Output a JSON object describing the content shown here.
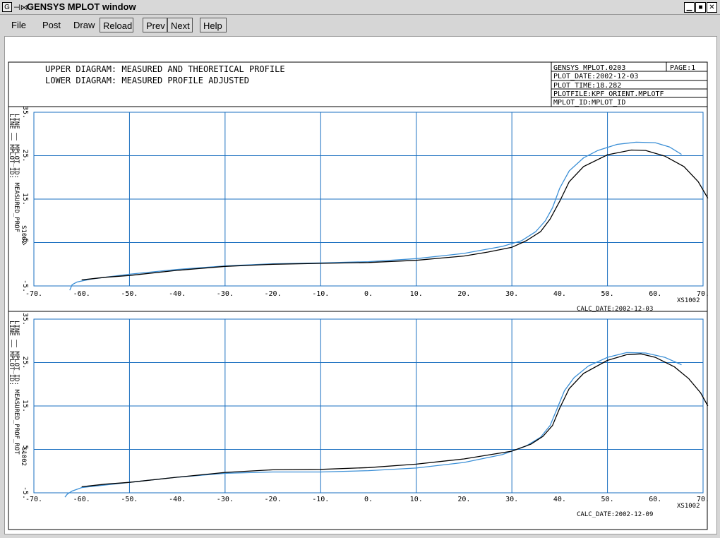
{
  "window": {
    "title": "GENSYS MPLOT window",
    "icon_label": "G"
  },
  "menu": {
    "file": "File",
    "post": "Post",
    "draw": "Draw",
    "reload": "Reload",
    "prev": "Prev",
    "next": "Next",
    "help": "Help"
  },
  "header": {
    "line1": "UPPER DIAGRAM: MEASURED AND THEORETICAL PROFILE",
    "line2": "LOWER DIAGRAM: MEASURED PROFILE ADJUSTED",
    "info": [
      "GENSYS MPLOT.0203",
      "PLOT_DATE:2002-12-03",
      "PLOT_TIME:18.282",
      "PLOTFILE:KPF_ORIENT.MPLOTF",
      "MPLOT_ID:MPLOT_ID"
    ],
    "page": "PAGE:1"
  },
  "colors": {
    "measured": "#3b8fd6",
    "theoretical": "#000000",
    "grid": "#1a6fc0"
  },
  "chart_data": [
    {
      "type": "line",
      "xlim": [
        -70,
        70
      ],
      "ylim": [
        -5,
        35
      ],
      "x_ticks": [
        "-70.",
        "-60.",
        "-50.",
        "-40.",
        "-30.",
        "-20.",
        "-10.",
        "0.",
        "10.",
        "20.",
        "30.",
        "40.",
        "50.",
        "60.",
        "70."
      ],
      "y_ticks": [
        "-5.",
        "5.",
        "15.",
        "25.",
        "35."
      ],
      "xlabel": "XS1002",
      "ylabel": "S1002",
      "legend": [
        "LINE —— MPLOT_ID:",
        "LINE —— MPLOT_ID: MEASURED_PROF"
      ],
      "footer": "CALC_DATE:2002-12-03",
      "series": [
        {
          "name": "MEASURED_PROF",
          "color": "#3b8fd6",
          "x": [
            -62.5,
            -62,
            -61,
            -58,
            -50,
            -40,
            -30,
            -20,
            -10,
            0,
            10,
            20,
            28,
            32,
            35,
            37,
            38.5,
            40,
            42,
            45,
            48,
            52,
            56,
            60,
            63,
            65.5
          ],
          "y": [
            -6,
            -4.7,
            -4.1,
            -3.4,
            -2.3,
            -1.2,
            -0.4,
            0.1,
            0.3,
            0.6,
            1.3,
            2.5,
            4.1,
            5.4,
            7.5,
            10,
            13,
            17.5,
            21.5,
            24.5,
            26.2,
            27.6,
            28.1,
            28,
            27,
            25.3
          ]
        },
        {
          "name": "MPLOT_ID",
          "color": "#000000",
          "x": [
            -60,
            -55,
            -50,
            -40,
            -30,
            -20,
            -10,
            0,
            10,
            20,
            25,
            30,
            33,
            36,
            38,
            40,
            42,
            45,
            50,
            55,
            58,
            62,
            66,
            69,
            71
          ],
          "y": [
            -3.6,
            -3,
            -2.6,
            -1.4,
            -0.5,
            0,
            0.2,
            0.4,
            0.9,
            1.9,
            2.8,
            3.9,
            5.4,
            7.5,
            10.4,
            14.5,
            19,
            22.5,
            25.2,
            26.3,
            26.2,
            24.9,
            22.5,
            19,
            15.2
          ]
        }
      ]
    },
    {
      "type": "line",
      "xlim": [
        -70,
        70
      ],
      "ylim": [
        -5,
        35
      ],
      "x_ticks": [
        "-70.",
        "-60.",
        "-50.",
        "-40.",
        "-30.",
        "-20.",
        "-10.",
        "0.",
        "10.",
        "20.",
        "30.",
        "40.",
        "50.",
        "60.",
        "70."
      ],
      "y_ticks": [
        "-5.",
        "5.",
        "15.",
        "25.",
        "35."
      ],
      "xlabel": "XS1002",
      "ylabel": "S1002",
      "legend": [
        "LINE —— MPLOT_ID:",
        "LINE —— MPLOT_ID: MEASURED_PROF_ROT"
      ],
      "footer": "CALC_DATE:2002-12-09",
      "series": [
        {
          "name": "MEASURED_PROF_ROT",
          "color": "#3b8fd6",
          "x": [
            -63.5,
            -63,
            -62,
            -60,
            -50,
            -40,
            -30,
            -20,
            -10,
            0,
            10,
            20,
            28,
            33,
            36,
            38,
            39.5,
            41,
            43,
            46,
            50,
            54,
            58,
            62,
            65.5
          ],
          "y": [
            -6,
            -5.3,
            -4.6,
            -3.8,
            -2.6,
            -1.4,
            -0.5,
            -0.2,
            -0.2,
            0.1,
            0.7,
            2,
            3.8,
            5.8,
            7.8,
            10.5,
            14.5,
            18.5,
            21.5,
            24.2,
            26.2,
            27.3,
            27.2,
            26.2,
            24.5
          ]
        },
        {
          "name": "MPLOT_ID",
          "color": "#000000",
          "x": [
            -60,
            -55,
            -50,
            -40,
            -30,
            -20,
            -10,
            0,
            10,
            20,
            30,
            34,
            36.5,
            38.5,
            40,
            42,
            45,
            50,
            54,
            57,
            60,
            64,
            67,
            69.5,
            71
          ],
          "y": [
            -3.6,
            -3,
            -2.6,
            -1.4,
            -0.3,
            0.3,
            0.4,
            0.8,
            1.6,
            2.8,
            4.6,
            6.2,
            8,
            10.5,
            14.5,
            19,
            22.5,
            25.5,
            26.8,
            27,
            26.2,
            24,
            21.3,
            18,
            15
          ]
        }
      ]
    }
  ]
}
